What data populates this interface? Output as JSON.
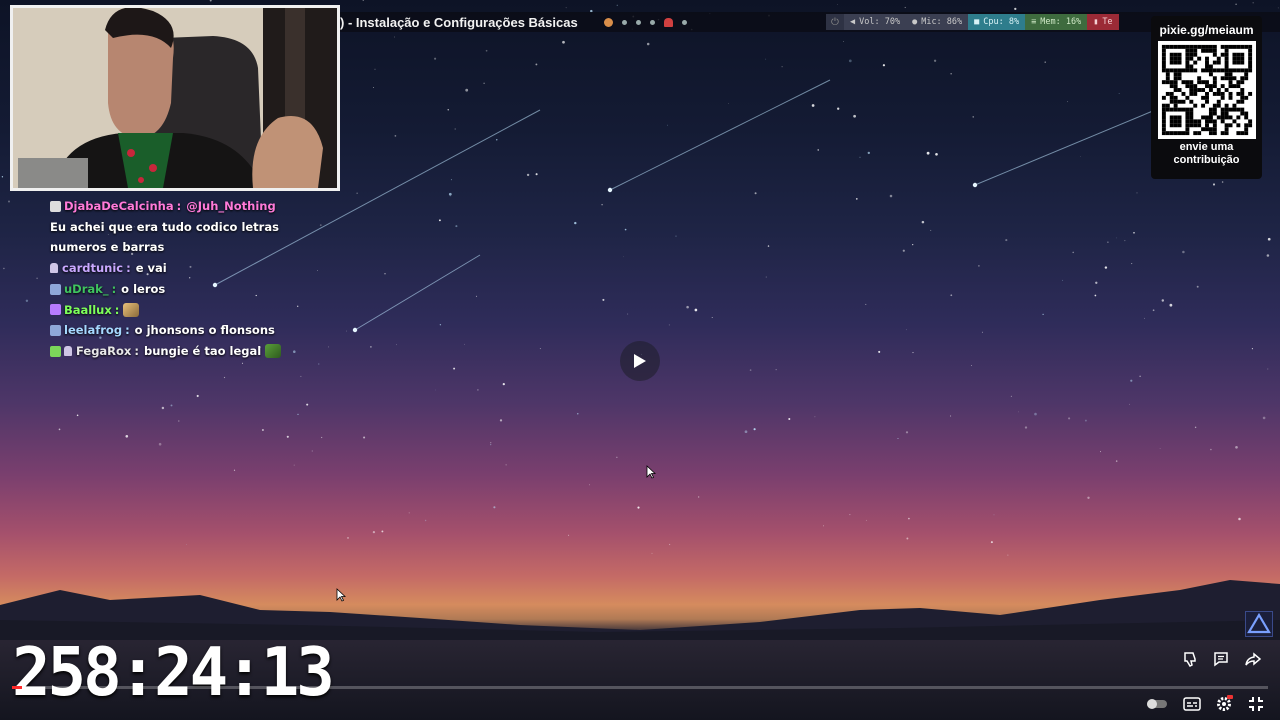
{
  "header": {
    "video_title": ") - Instalação e Configurações Básicas",
    "status": {
      "vol": "Vol: 70%",
      "mic": "Mic: 86%",
      "cpu": "Cpu: 8%",
      "mem": "Mem: 16%",
      "temp": "Te"
    }
  },
  "chat": {
    "messages": [
      {
        "user": "DjabaDeCalcinha",
        "user_color": "#ff7ad9",
        "text": "@Juh_Nothing",
        "text_color": "#ff7ad9",
        "badge_color": "#ddd",
        "mic": false,
        "emote": false
      },
      {
        "user": "",
        "user_color": "#ffffff",
        "text": "Eu achei que era tudo codico letras",
        "text_color": "#ffffff",
        "badge_color": "",
        "mic": false,
        "emote": false
      },
      {
        "user": "",
        "user_color": "#ffffff",
        "text": "numeros e barras",
        "text_color": "#ffffff",
        "badge_color": "",
        "mic": false,
        "emote": false
      },
      {
        "user": "cardtunic",
        "user_color": "#c9a8ff",
        "text": "e vai",
        "text_color": "#ffffff",
        "badge_color": "",
        "mic": true,
        "emote": false
      },
      {
        "user": "uDrak_",
        "user_color": "#3fc35f",
        "text": "o leros",
        "text_color": "#ffffff",
        "badge_color": "#8fa8d8",
        "mic": false,
        "emote": false
      },
      {
        "user": "Baallux",
        "user_color": "#7dff5a",
        "text": "",
        "text_color": "#ffffff",
        "badge_color": "#b77bff",
        "mic": false,
        "emote": true
      },
      {
        "user": "leelafrog",
        "user_color": "#a6d8ff",
        "text": "o jhonsons o flonsons",
        "text_color": "#ffffff",
        "badge_color": "#8fa8d8",
        "mic": false,
        "emote": false
      },
      {
        "user": "FegaRox",
        "user_color": "#e8e8e8",
        "text": "bungie é tao legal",
        "text_color": "#ffffff",
        "badge_color": "#7cd65a",
        "mic": true,
        "emote": true
      }
    ]
  },
  "donation": {
    "url": "pixie.gg/meiaum",
    "text_line1": "envie uma",
    "text_line2": "contribuição"
  },
  "player": {
    "timer": "258:24:13",
    "progress": 0.008
  },
  "colors": {
    "accent_red": "#ff2a2a"
  }
}
